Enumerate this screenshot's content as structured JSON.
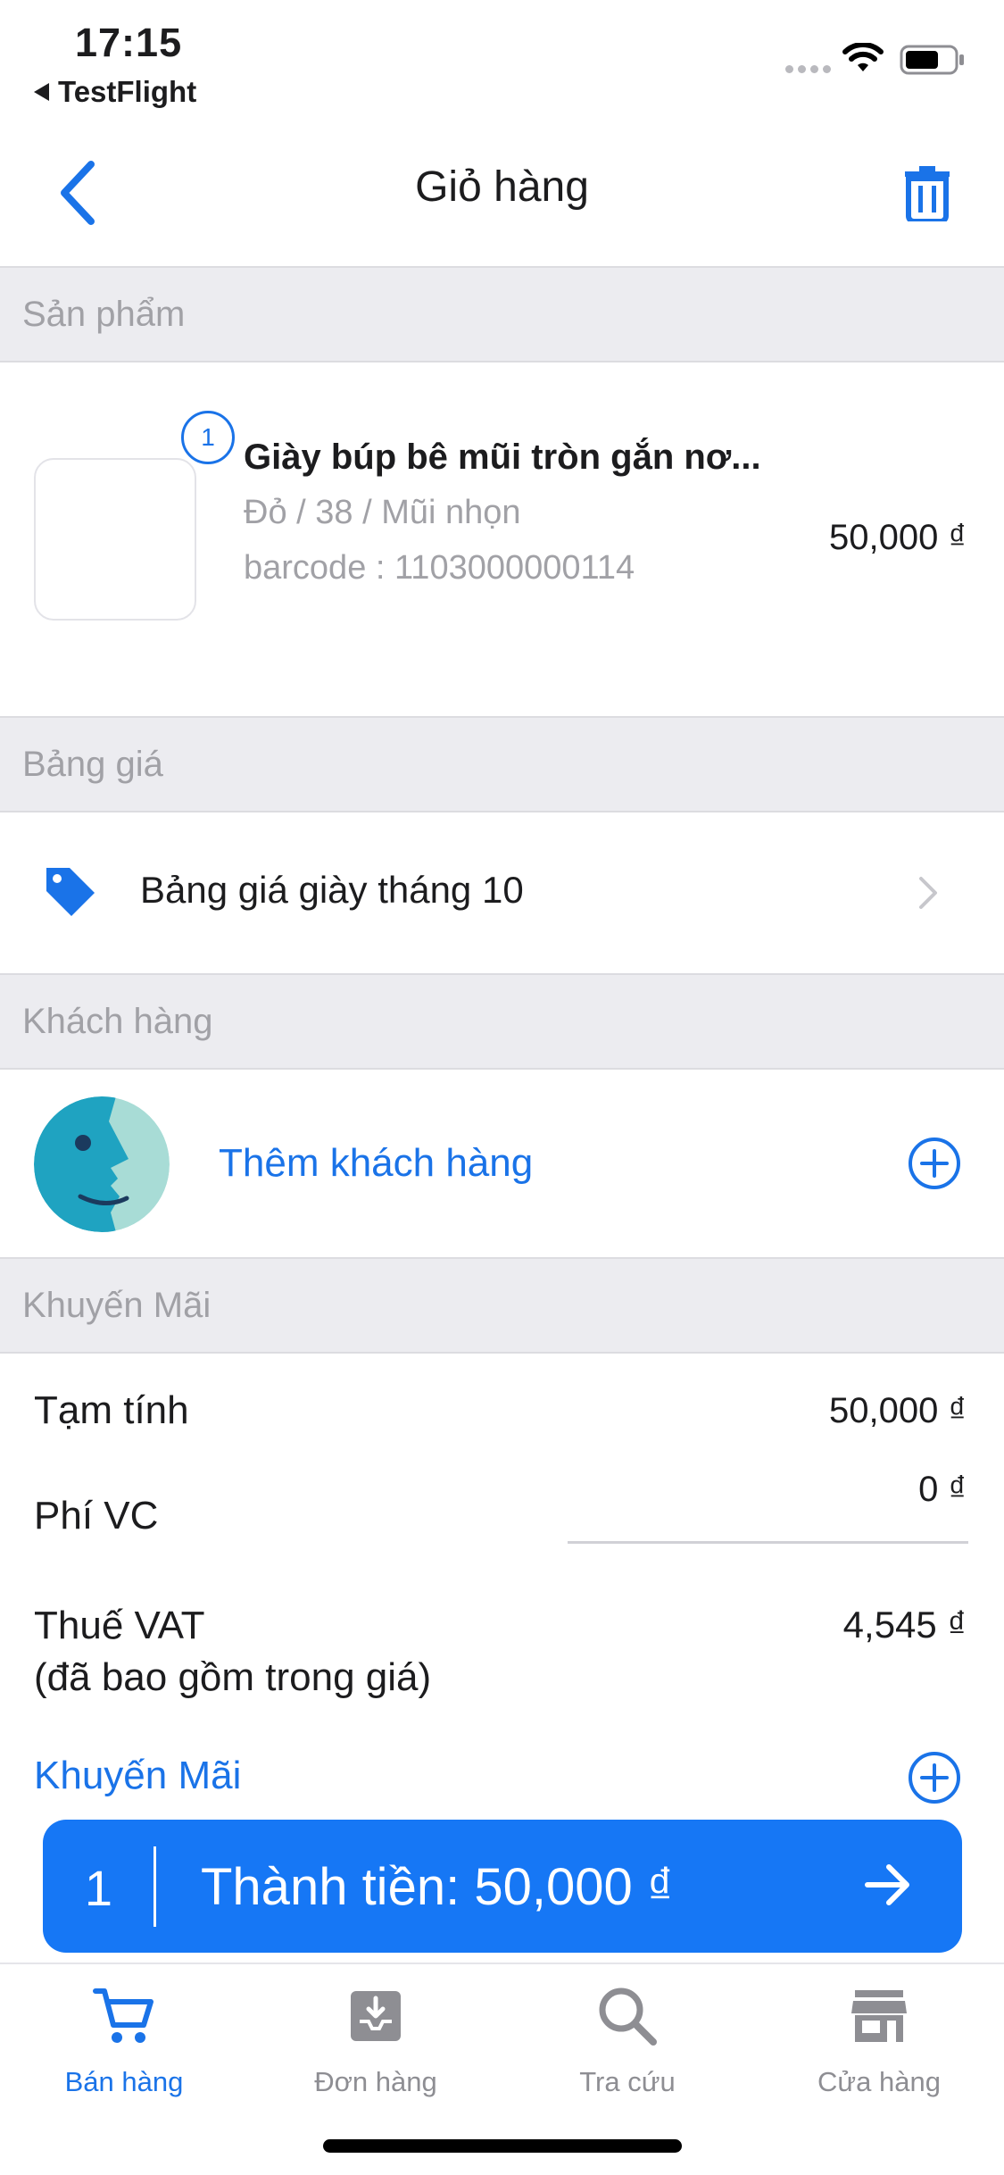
{
  "status_bar": {
    "time": "17:15",
    "back_app": "TestFlight",
    "icons": [
      "cellular-dots-icon",
      "wifi-icon",
      "battery-icon"
    ]
  },
  "header": {
    "title": "Giỏ hàng",
    "back_icon": "chevron-left-icon",
    "delete_icon": "trash-icon"
  },
  "sections": {
    "products": "Sản phẩm",
    "price_list": "Bảng giá",
    "customer": "Khách hàng",
    "promotion": "Khuyến Mãi"
  },
  "product": {
    "quantity_badge": "1",
    "name": "Giày búp bê mũi tròn gắn nơ...",
    "variant": "Đỏ / 38 / Mũi nhọn",
    "barcode": "barcode : 1103000000114",
    "price": "50,000 ₫"
  },
  "price_list": {
    "name": "Bảng giá giày tháng 10",
    "icon": "price-tag-icon"
  },
  "customer": {
    "add_label": "Thêm khách hàng",
    "icon": "add-circle-icon"
  },
  "totals": {
    "subtotal_label": "Tạm tính",
    "subtotal_value": "50,000 ₫",
    "shipping_label": "Phí VC",
    "shipping_value": "0 ₫",
    "vat_label": "Thuế VAT",
    "vat_note": "(đã bao gồm trong giá)",
    "vat_value": "4,545 ₫",
    "promotion_link": "Khuyến Mãi"
  },
  "checkout": {
    "count": "1",
    "total_label": "Thành tiền: 50,000 ₫"
  },
  "tabbar": [
    {
      "label": "Bán hàng",
      "icon": "cart-icon",
      "active": true
    },
    {
      "label": "Đơn hàng",
      "icon": "inbox-download-icon",
      "active": false
    },
    {
      "label": "Tra cứu",
      "icon": "search-icon",
      "active": false
    },
    {
      "label": "Cửa hàng",
      "icon": "store-icon",
      "active": false
    }
  ],
  "colors": {
    "accent": "#1a73e8",
    "checkout_bg": "#1677f5",
    "section_bg": "#ececf0",
    "muted_text": "#a1a1a6",
    "avatar_dark": "#1fa3c1",
    "avatar_light": "#a8dcd6"
  }
}
